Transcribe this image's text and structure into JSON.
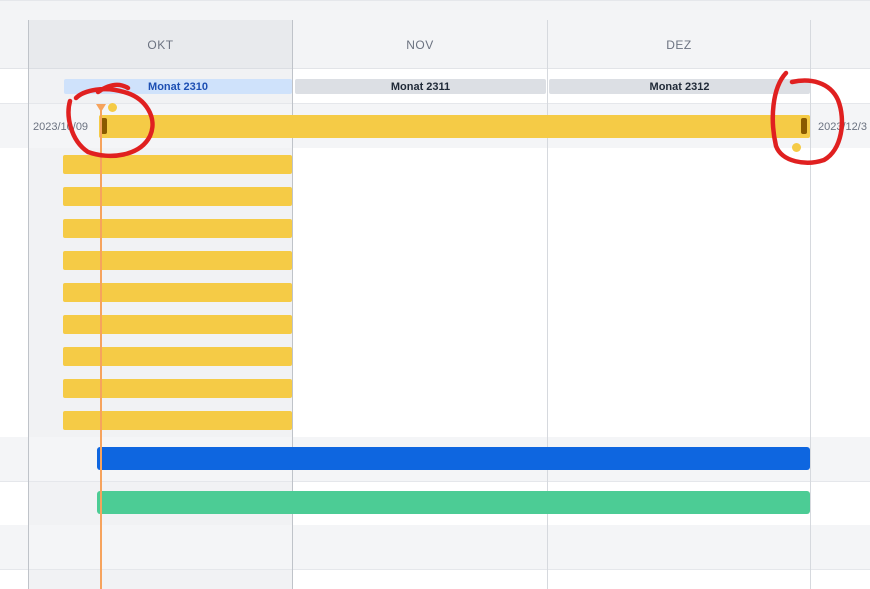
{
  "timeline": {
    "months": [
      "OKT",
      "NOV",
      "DEZ"
    ],
    "milestones": [
      "Monat 2310",
      "Monat 2311",
      "Monat 2312"
    ],
    "summary_row": {
      "start_date": "2023/10/09",
      "end_date": "2023/12/3"
    },
    "colors": {
      "accent_blue": "#0e66e0",
      "green": "#4ccc95",
      "yellow": "#f5cb46",
      "today_line": "#f6a35d",
      "annotation_red": "#e02020"
    }
  }
}
